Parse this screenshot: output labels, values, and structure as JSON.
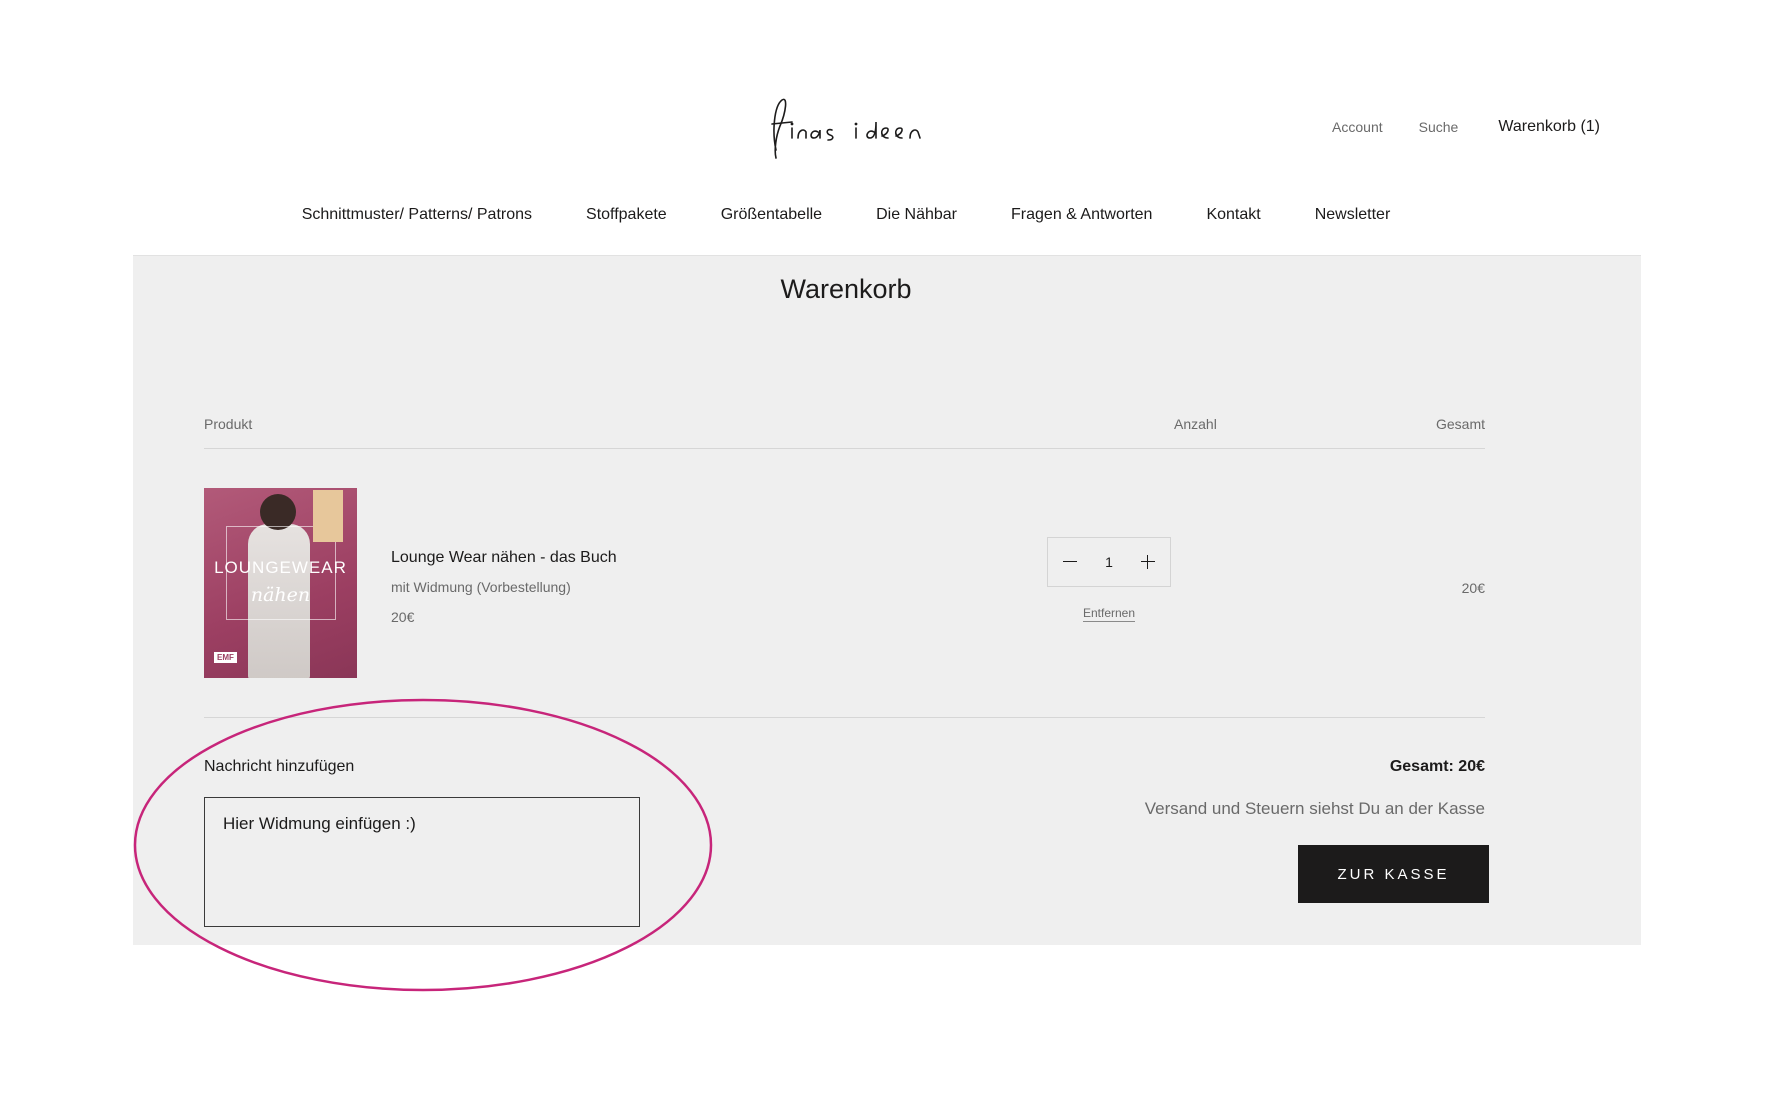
{
  "header": {
    "logo_text": "finas ideen",
    "account_label": "Account",
    "search_label": "Suche",
    "cart_label": "Warenkorb (1)"
  },
  "nav": {
    "items": [
      {
        "label": "Schnittmuster/ Patterns/ Patrons"
      },
      {
        "label": "Stoffpakete"
      },
      {
        "label": "Größentabelle"
      },
      {
        "label": "Die Nähbar"
      },
      {
        "label": "Fragen & Antworten"
      },
      {
        "label": "Kontakt"
      },
      {
        "label": "Newsletter"
      }
    ]
  },
  "cart": {
    "title": "Warenkorb",
    "columns": {
      "product": "Produkt",
      "quantity": "Anzahl",
      "total": "Gesamt"
    },
    "item": {
      "cover_text": "LOUNGEWEAR",
      "cover_script": "nähen",
      "cover_badge": "EMF",
      "title": "Lounge Wear nähen - das Buch",
      "variant": "mit Widmung (Vorbestellung)",
      "price": "20€",
      "quantity": "1",
      "remove_label": "Entfernen",
      "line_total": "20€"
    },
    "note": {
      "label": "Nachricht hinzufügen",
      "value": "Hier Widmung einfügen :)"
    },
    "summary": {
      "total": "Gesamt: 20€",
      "shipping_note": "Versand und Steuern siehst Du an der Kasse",
      "checkout_label": "ZUR KASSE"
    }
  },
  "colors": {
    "accent_dark": "#1c1b1b",
    "panel_bg": "#efefef",
    "highlight": "#c7257a"
  }
}
